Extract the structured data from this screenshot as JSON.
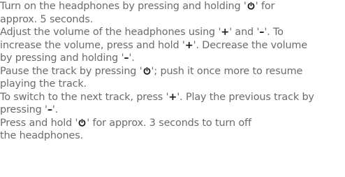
{
  "instructions": {
    "l1a": "Turn on the headphones by pressing and holding '",
    "l1b": "' for",
    "l2": "approx. 5 seconds.",
    "l3a": "Adjust the volume of the headphones using '",
    "l3plus": "+",
    "l3b": "' and '",
    "l3minus": "–",
    "l3c": "'. To",
    "l4a": "increase the volume, press and hold '",
    "l4plus": "+",
    "l4b": "'. Decrease the volume",
    "l5a": "by pressing and holding '",
    "l5minus": "–",
    "l5b": "'.",
    "l6a": "Pause the track by pressing '",
    "l6b": "'; push it once more to resume",
    "l7": "playing the track.",
    "l8a": "To switch to the next track, press '",
    "l8plus": "+",
    "l8b": "'. Play the previous track by",
    "l9a": "pressing '",
    "l9minus": "–",
    "l9b": "'.",
    "l10a": "Press and hold '",
    "l10b": "' for approx. 3 seconds to turn off",
    "l11": "the headphones."
  },
  "icons": {
    "power": "power-icon"
  }
}
